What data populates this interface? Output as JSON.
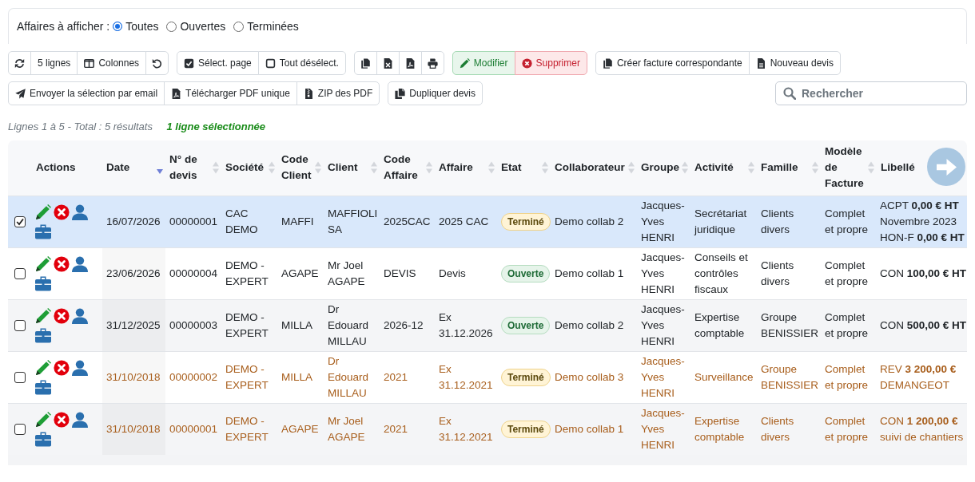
{
  "filter": {
    "label": "Affaires à afficher :",
    "options": [
      {
        "label": "Toutes",
        "selected": true
      },
      {
        "label": "Ouvertes",
        "selected": false
      },
      {
        "label": "Terminées",
        "selected": false
      }
    ]
  },
  "toolbar": {
    "row_1": [
      {
        "label": "5 lignes",
        "kind": "plain"
      },
      {
        "label": "Colonnes",
        "kind": "plain"
      },
      {
        "label": "Sélect. page",
        "kind": "plain"
      },
      {
        "label": "Tout désélect.",
        "kind": "plain"
      },
      {
        "label": "Modifier",
        "kind": "success"
      },
      {
        "label": "Supprimer",
        "kind": "danger"
      },
      {
        "label": "Créer facture correspondante",
        "kind": "plain"
      },
      {
        "label": "Nouveau devis",
        "kind": "plain"
      }
    ],
    "row_2": [
      {
        "label": "Envoyer la sélection par email"
      },
      {
        "label": "Télécharger PDF unique"
      },
      {
        "label": "ZIP des PDF"
      },
      {
        "label": "Dupliquer devis"
      }
    ]
  },
  "search": {
    "placeholder": "Rechercher"
  },
  "status": {
    "summary": "Lignes 1 à 5 - Total : 5 résultats",
    "selection": "1 ligne sélectionnée"
  },
  "table": {
    "columns": [
      {
        "label": "Actions",
        "sortable": false
      },
      {
        "label": "Date",
        "sortable": true,
        "sorted": true
      },
      {
        "label": "N° de devis",
        "sortable": true,
        "sorted": false
      },
      {
        "label": "Société",
        "sortable": true,
        "sorted": false
      },
      {
        "label": "Code Client",
        "sortable": true,
        "sorted": false
      },
      {
        "label": "Client",
        "sortable": true,
        "sorted": false
      },
      {
        "label": "Code Affaire",
        "sortable": true,
        "sorted": false
      },
      {
        "label": "Affaire",
        "sortable": true,
        "sorted": false
      },
      {
        "label": "Etat",
        "sortable": true,
        "sorted": false
      },
      {
        "label": "Collaborateur",
        "sortable": true,
        "sorted": false
      },
      {
        "label": "Groupe",
        "sortable": true,
        "sorted": false
      },
      {
        "label": "Activité",
        "sortable": true,
        "sorted": false
      },
      {
        "label": "Famille",
        "sortable": true,
        "sorted": false
      },
      {
        "label": "Modèle de Facture",
        "sortable": true,
        "sorted": false
      },
      {
        "label": "Libellé",
        "sortable": false
      }
    ],
    "rows": [
      {
        "selected": true,
        "color": "#212529",
        "date": "16/07/2026",
        "numero": "00000001",
        "societe": "CAC DEMO",
        "code_client": "MAFFI",
        "client": "MAFFIOLI SA",
        "code_affaire": "2025CAC",
        "affaire": "2025 CAC",
        "etat": {
          "label": "Terminé",
          "kind": "finished"
        },
        "collaborateur": "Demo collab 2",
        "groupe": "Jacques-Yves HENRI",
        "activite": "Secrétariat juridique",
        "famille": "Clients divers",
        "modele_facture": "Complet et propre",
        "libelle": [
          "ACPT **0,00 € HT**",
          "Novembre 2023",
          "HON-F **0,00 € HT**"
        ]
      },
      {
        "selected": false,
        "color": "#212529",
        "date": "23/06/2026",
        "numero": "00000004",
        "societe": "DEMO - EXPERT",
        "code_client": "AGAPE",
        "client": "Mr Joel AGAPE",
        "code_affaire": "DEVIS",
        "affaire": "Devis",
        "etat": {
          "label": "Ouverte",
          "kind": "open"
        },
        "collaborateur": "Demo collab 1",
        "groupe": "Jacques-Yves HENRI",
        "activite": "Conseils et contrôles fiscaux",
        "famille": "Clients divers",
        "modele_facture": "Complet et propre",
        "libelle": [
          "CON **100,00 € HT**"
        ]
      },
      {
        "selected": false,
        "color": "#212529",
        "date": "31/12/2025",
        "numero": "00000003",
        "societe": "DEMO - EXPERT",
        "code_client": "MILLA",
        "client": "Dr Edouard MILLAU",
        "code_affaire": "2026-12",
        "affaire": "Ex 31.12.2026",
        "etat": {
          "label": "Ouverte",
          "kind": "open"
        },
        "collaborateur": "Demo collab 2",
        "groupe": "Jacques-Yves HENRI",
        "activite": "Expertise comptable",
        "famille": "Groupe BENISSIER",
        "modele_facture": "Complet et propre",
        "libelle": [
          "CON **500,00 € HT**"
        ]
      },
      {
        "selected": false,
        "color": "#a85e1c",
        "date": "31/10/2018",
        "numero": "00000002",
        "societe": "DEMO - EXPERT",
        "code_client": "MILLA",
        "client": "Dr Edouard MILLAU",
        "code_affaire": "2021",
        "affaire": "Ex 31.12.2021",
        "etat": {
          "label": "Terminé",
          "kind": "finished"
        },
        "collaborateur": "Demo collab 3",
        "groupe": "Jacques-Yves HENRI",
        "activite": "Surveillance",
        "famille": "Groupe BENISSIER",
        "modele_facture": "Complet et propre",
        "libelle": [
          "REV **3 200,00 €**",
          "DEMANGEOT"
        ]
      },
      {
        "selected": false,
        "color": "#a85e1c",
        "date": "31/10/2018",
        "numero": "00000001",
        "societe": "DEMO - EXPERT",
        "code_client": "AGAPE",
        "client": "Mr Joel AGAPE",
        "code_affaire": "2021",
        "affaire": "Ex 31.12.2021",
        "etat": {
          "label": "Terminé",
          "kind": "finished"
        },
        "collaborateur": "Demo collab 1",
        "groupe": "Jacques-Yves HENRI",
        "activite": "Expertise comptable",
        "famille": "Clients divers",
        "modele_facture": "Complet et propre",
        "libelle": [
          "CON **1 200,00 €**",
          "suivi de chantiers"
        ]
      }
    ]
  }
}
